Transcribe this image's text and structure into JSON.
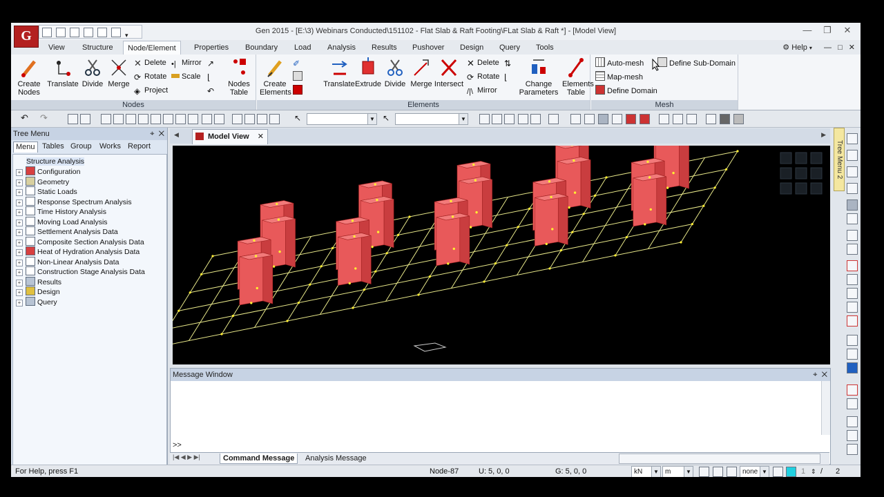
{
  "window": {
    "logo": "G",
    "title": "Gen 2015 - [E:\\3) Webinars Conducted\\151102 - Flat Slab & Raft Footing\\FLat Slab & Raft *] - [Model View]",
    "min": "—",
    "restore": "❐",
    "close": "✕"
  },
  "tabs": [
    "View",
    "Structure",
    "Node/Element",
    "Properties",
    "Boundary",
    "Load",
    "Analysis",
    "Results",
    "Pushover",
    "Design",
    "Query",
    "Tools"
  ],
  "active_tab": "Node/Element",
  "help_label": "Help",
  "ribbon": {
    "nodes": {
      "title": "Nodes",
      "create": "Create\nNodes",
      "translate": "Translate",
      "divide": "Divide",
      "merge": "Merge",
      "delete": "Delete",
      "rotate": "Rotate",
      "project": "Project",
      "mirror": "Mirror",
      "scale": "Scale",
      "table": "Nodes\nTable"
    },
    "elements": {
      "title": "Elements",
      "create": "Create\nElements",
      "translate": "Translate",
      "extrude": "Extrude",
      "divide": "Divide",
      "merge": "Merge",
      "intersect": "Intersect",
      "delete": "Delete",
      "rotate": "Rotate",
      "mirror": "Mirror",
      "change": "Change\nParameters",
      "table": "Elements\nTable"
    },
    "mesh": {
      "title": "Mesh",
      "automesh": "Auto-mesh",
      "mapmesh": "Map-mesh",
      "define_domain": "Define Domain",
      "define_sub": "Define Sub-Domain"
    }
  },
  "tree": {
    "header": "Tree Menu",
    "tabs": [
      "Menu",
      "Tables",
      "Group",
      "Works",
      "Report"
    ],
    "active_tab": "Menu",
    "root": "Structure Analysis",
    "items": [
      "Configuration",
      "Geometry",
      "Static Loads",
      "Response Spectrum Analysis",
      "Time History Analysis",
      "Moving Load Analysis",
      "Settlement Analysis Data",
      "Composite Section Analysis Data",
      "Heat of Hydration Analysis Data",
      "Non-Linear Analysis Data",
      "Construction Stage Analysis Data",
      "Results",
      "Design",
      "Query"
    ]
  },
  "model_view": {
    "tab_label": "Model View",
    "sidebar_tab": "Tree Menu 2"
  },
  "message_window": {
    "title": "Message Window",
    "prompt": ">>",
    "tabs": [
      "Command Message",
      "Analysis Message"
    ]
  },
  "status": {
    "help": "For Help, press F1",
    "node": "Node-87",
    "ucs": "U: 5, 0, 0",
    "gcs": "G: 5, 0, 0",
    "force_unit": "kN",
    "length_unit": "m",
    "filter": "none",
    "page_current": "1",
    "page_total": "2"
  },
  "colors": {
    "column_front": "#e8595a",
    "column_side": "#c93d3f",
    "column_top": "#f27a7a",
    "grid": "#e9e98a",
    "node": "#ffee33",
    "viewport_bg": "#000000"
  }
}
